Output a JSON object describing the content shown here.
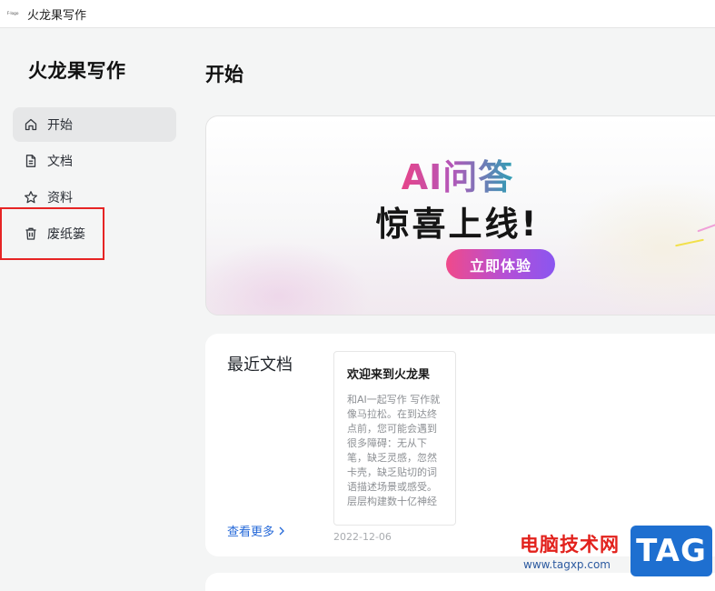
{
  "window": {
    "title": "火龙果写作",
    "app_icon_text": "F·logo"
  },
  "sidebar": {
    "brand": "火龙果写作",
    "items": [
      {
        "label": "开始",
        "icon": "home-icon",
        "active": true
      },
      {
        "label": "文档",
        "icon": "document-icon",
        "active": false
      },
      {
        "label": "资料",
        "icon": "star-icon",
        "active": false
      },
      {
        "label": "废纸篓",
        "icon": "trash-icon",
        "active": false
      }
    ]
  },
  "main": {
    "title": "开始",
    "banner": {
      "headline": "AI问答",
      "subline": "惊喜上线!",
      "cta_label": "立即体验"
    },
    "recent": {
      "title": "最近文档",
      "see_more": "查看更多",
      "documents": [
        {
          "title": "欢迎来到火龙果",
          "excerpt": "和AI一起写作 写作就像马拉松。在到达终点前，您可能会遇到很多障碍：无从下笔，缺乏灵感，忽然卡壳，缺乏贴切的词语描述场景或感受。 层层构建数十亿神经",
          "date": "2022-12-06"
        }
      ]
    }
  },
  "colors": {
    "highlight_border": "#e62424",
    "link": "#2468d8",
    "cta_gradient_start": "#f04a8a",
    "cta_gradient_end": "#8a56f0"
  },
  "watermark": {
    "site_name": "电脑技术网",
    "url": "www.tagxp.com",
    "tag": "TAG"
  }
}
